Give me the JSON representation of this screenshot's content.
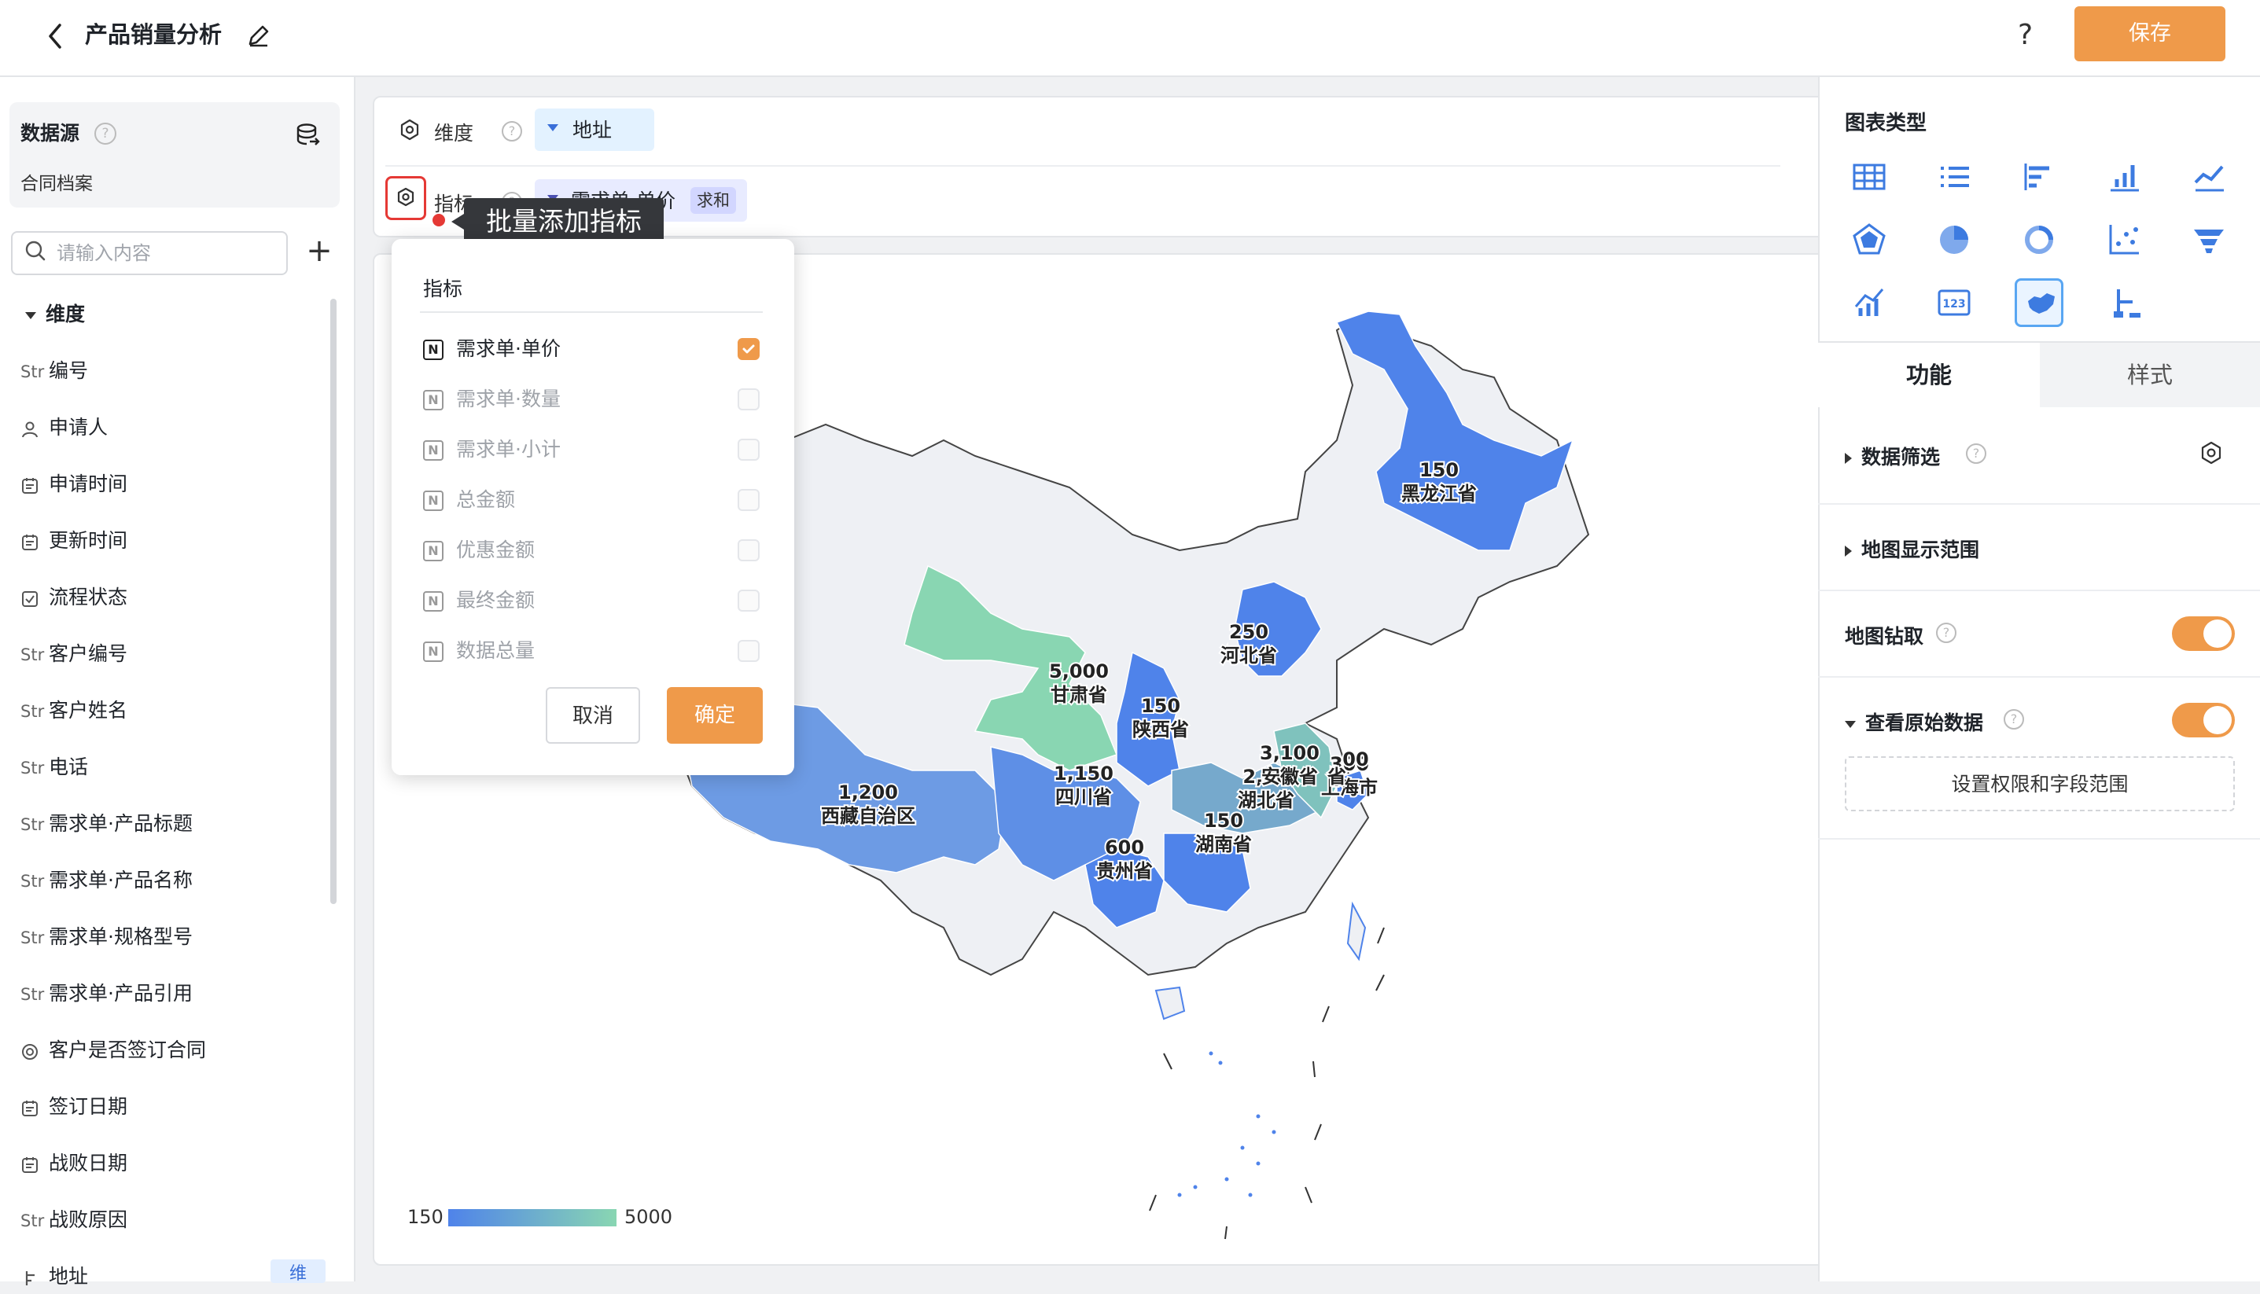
{
  "header": {
    "title": "产品销量分析",
    "help": "?",
    "save_label": "保存"
  },
  "datasource": {
    "title": "数据源",
    "help": "?",
    "name": "合同档案"
  },
  "search": {
    "placeholder": "请输入内容"
  },
  "fields": {
    "dimension_header": "维度",
    "items": [
      {
        "type": "Str",
        "label": "编号"
      },
      {
        "type": "user",
        "label": "申请人"
      },
      {
        "type": "date",
        "label": "申请时间"
      },
      {
        "type": "date",
        "label": "更新时间"
      },
      {
        "type": "check",
        "label": "流程状态"
      },
      {
        "type": "Str",
        "label": "客户编号"
      },
      {
        "type": "Str",
        "label": "客户姓名"
      },
      {
        "type": "Str",
        "label": "电话"
      },
      {
        "type": "Str",
        "label": "需求单·产品标题"
      },
      {
        "type": "Str",
        "label": "需求单·产品名称"
      },
      {
        "type": "Str",
        "label": "需求单·规格型号"
      },
      {
        "type": "Str",
        "label": "需求单·产品引用"
      },
      {
        "type": "radio",
        "label": "客户是否签订合同"
      },
      {
        "type": "date",
        "label": "签订日期"
      },
      {
        "type": "date",
        "label": "战败日期"
      },
      {
        "type": "Str",
        "label": "战败原因"
      },
      {
        "type": "geo",
        "label": "地址"
      }
    ],
    "dim_badge": "维"
  },
  "config": {
    "dimension_label": "维度",
    "dimension_value": "地址",
    "metric_label": "指标",
    "metric_value": "需求单·单价",
    "metric_agg": "求和",
    "tooltip": "批量添加指标"
  },
  "popup": {
    "title": "指标",
    "options": [
      {
        "label": "需求单·单价",
        "checked": true,
        "enabled": true
      },
      {
        "label": "需求单·数量",
        "checked": false,
        "enabled": false
      },
      {
        "label": "需求单·小计",
        "checked": false,
        "enabled": false
      },
      {
        "label": "总金额",
        "checked": false,
        "enabled": false
      },
      {
        "label": "优惠金额",
        "checked": false,
        "enabled": false
      },
      {
        "label": "最终金额",
        "checked": false,
        "enabled": false
      },
      {
        "label": "数据总量",
        "checked": false,
        "enabled": false
      }
    ],
    "cancel_label": "取消",
    "confirm_label": "确定"
  },
  "map": {
    "regions": [
      {
        "name": "黑龙江省",
        "value": "150"
      },
      {
        "name": "河北省",
        "value": "250"
      },
      {
        "name": "甘肃省",
        "value": "5,000"
      },
      {
        "name": "陕西省",
        "value": "150"
      },
      {
        "name": "四川省",
        "value": "1,150"
      },
      {
        "name": "西藏自治区",
        "value": "1,200"
      },
      {
        "name": "贵州省",
        "value": "600"
      },
      {
        "name": "湖南省",
        "value": "150"
      },
      {
        "name": "湖北省",
        "value": "2,30"
      },
      {
        "name": "安徽省",
        "value": "3,100"
      },
      {
        "name": "上海市",
        "value": "300"
      }
    ],
    "overlap_fragments": [
      "省",
      "00"
    ],
    "legend_min": "150",
    "legend_max": "5000",
    "colors": {
      "low": "#4f83ea",
      "high": "#89d6b2",
      "empty": "#eef0f4"
    }
  },
  "right_panel": {
    "chart_type_title": "图表类型",
    "chart_types": [
      "table-icon",
      "list-icon",
      "horizontal-bar-icon",
      "bar-chart-icon",
      "line-chart-icon",
      "radar-icon",
      "pie-icon",
      "donut-icon",
      "scatter-icon",
      "funnel-icon",
      "combo-chart-icon",
      "number-card-icon",
      "map-chart-icon",
      "tree-icon"
    ],
    "selected_chart_type": "map-chart-icon",
    "tabs": [
      "功能",
      "样式"
    ],
    "sections": {
      "data_filter": "数据筛选",
      "map_range": "地图显示范围",
      "drill": "地图钻取",
      "raw_data": "查看原始数据",
      "perm_button": "设置权限和字段范围"
    },
    "toggles": {
      "drill": true,
      "raw_data": true
    }
  },
  "accent_color": "#ef9a4a"
}
